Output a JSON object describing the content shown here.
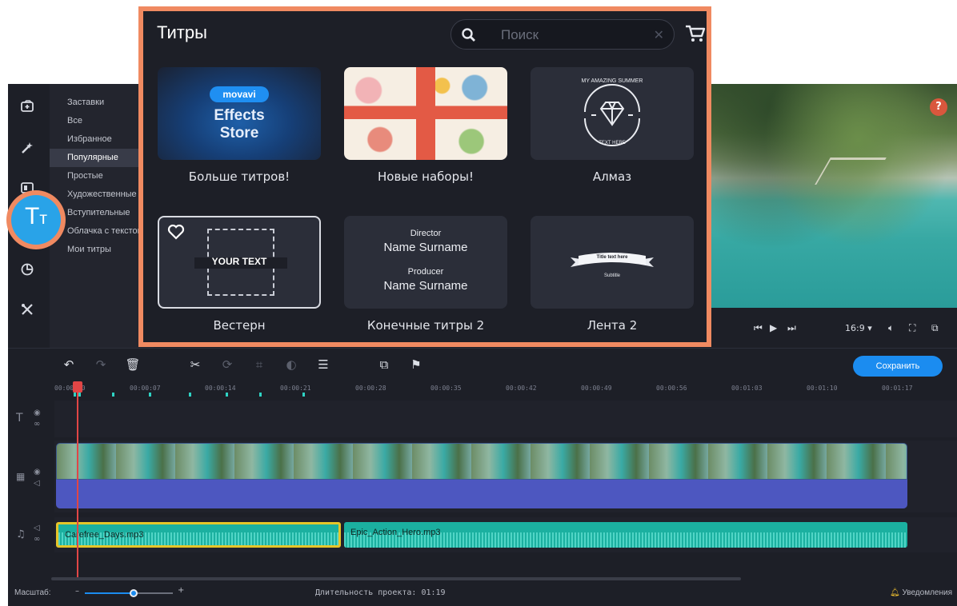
{
  "categories": {
    "items": [
      "Заставки",
      "Все",
      "Избранное",
      "Популярные",
      "Простые",
      "Художественные",
      "Вступительные",
      "Облачка с текстом",
      "Мои титры"
    ],
    "active_index": 3
  },
  "titles_tool": {
    "big": "T",
    "small": "т"
  },
  "titles_panel": {
    "heading": "Титры",
    "search": {
      "placeholder": "Поиск",
      "value": ""
    },
    "tiles": [
      {
        "label": "Больше титров!",
        "logo": "movavi",
        "text_line1": "Effects",
        "text_line2": "Store"
      },
      {
        "label": "Новые наборы!"
      },
      {
        "label": "Алмаз",
        "badge_top": "MY AMAZING SUMMER",
        "badge_bottom": "TEXT HERE"
      },
      {
        "label": "Вестерн",
        "center_text": "YOUR TEXT"
      },
      {
        "label": "Конечные титры 2",
        "role1": "Director",
        "name1": "Name Surname",
        "role2": "Producer",
        "name2": "Name Surname"
      },
      {
        "label": "Лента 2",
        "ribbon_text": "Title text here",
        "sub_text": "Subtitle"
      }
    ]
  },
  "preview": {
    "help": "?"
  },
  "player": {
    "aspect": "16:9 ▾"
  },
  "timeline": {
    "save_label": "Сохранить",
    "ticks": [
      "00:00:00",
      "00:00:07",
      "00:00:14",
      "00:00:21",
      "00:00:28",
      "00:00:35",
      "00:00:42",
      "00:00:49",
      "00:00:56",
      "00:01:03",
      "00:01:10",
      "00:01:17"
    ],
    "audio_clips": [
      {
        "name": "Carefree_Days.mp3"
      },
      {
        "name": "Epic_Action_Hero.mp3"
      }
    ]
  },
  "status": {
    "scale_label": "Масштаб:",
    "zoom_fraction": 0.55,
    "duration": "Длительность проекта: 01:19",
    "notifications": "Уведомления"
  },
  "colors": {
    "accent": "#1b8cf0",
    "highlight": "#f08a61",
    "audio": "#1bb0a0",
    "effect_track": "#4d57c0"
  }
}
